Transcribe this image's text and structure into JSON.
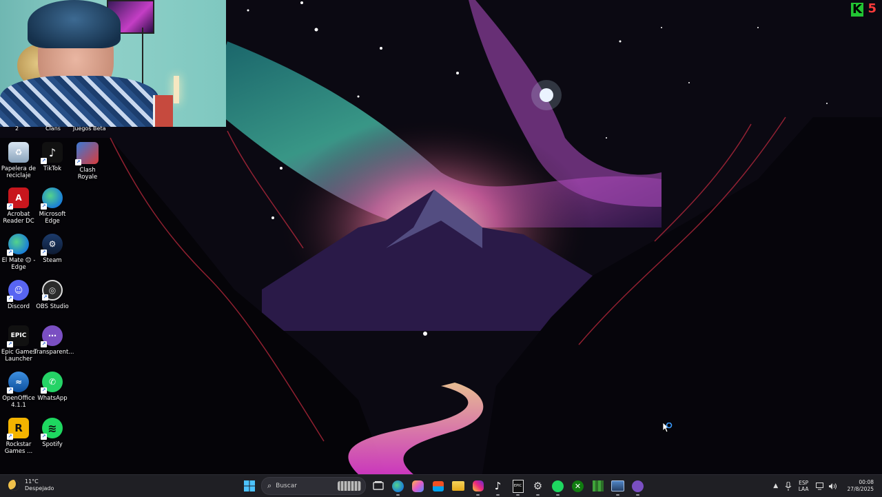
{
  "overlay_logo": {
    "letter": "K",
    "number": "5",
    "brand_color": "#22c533",
    "number_color": "#ff3b3b"
  },
  "desktop": {
    "cutoff_labels": [
      "2",
      "Clans",
      "Juegos Beta"
    ],
    "icons": [
      {
        "label": "Papelera de reciclaje",
        "icon": "recycle-bin-icon"
      },
      {
        "label": "TikTok",
        "icon": "tiktok-icon"
      },
      {
        "label": "Clash Royale",
        "icon": "clash-royale-icon"
      },
      {
        "label": "Acrobat Reader DC",
        "icon": "acrobat-icon"
      },
      {
        "label": "Microsoft Edge",
        "icon": "edge-icon"
      },
      {
        "label": "El Mate 😊 - Edge",
        "icon": "edge-profile-icon"
      },
      {
        "label": "Steam",
        "icon": "steam-icon"
      },
      {
        "label": "Discord",
        "icon": "discord-icon"
      },
      {
        "label": "OBS Studio",
        "icon": "obs-icon"
      },
      {
        "label": "Epic Games Launcher",
        "icon": "epic-games-icon"
      },
      {
        "label": "Transparent...",
        "icon": "transparent-app-icon"
      },
      {
        "label": "OpenOffice 4.1.1",
        "icon": "openoffice-icon"
      },
      {
        "label": "WhatsApp",
        "icon": "whatsapp-icon"
      },
      {
        "label": "Rockstar Games ...",
        "icon": "rockstar-icon"
      },
      {
        "label": "Spotify",
        "icon": "spotify-icon"
      }
    ]
  },
  "taskbar": {
    "weather": {
      "temp": "11°C",
      "condition": "Despejado"
    },
    "search_placeholder": "Buscar",
    "apps": [
      "start-icon",
      "search",
      "task-view-icon",
      "edge-icon",
      "copilot-icon",
      "store-icon",
      "file-explorer-icon",
      "instagram-icon",
      "tiktok-icon",
      "epic-games-icon",
      "chatgpt-icon",
      "spotify-icon",
      "xbox-icon",
      "minecraft-icon",
      "media-icon",
      "transparent-app-icon"
    ],
    "tray": {
      "lang_1": "ESP",
      "lang_2": "LAA",
      "time": "00:08",
      "date": "27/8/2025"
    }
  }
}
